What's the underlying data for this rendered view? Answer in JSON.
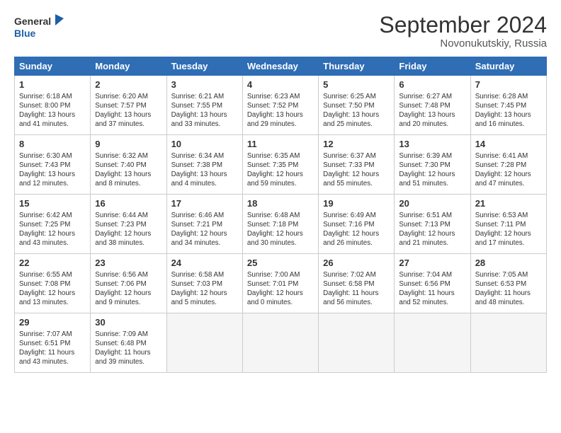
{
  "header": {
    "logo_line1": "General",
    "logo_line2": "Blue",
    "month": "September 2024",
    "location": "Novonukutskiy, Russia"
  },
  "days_of_week": [
    "Sunday",
    "Monday",
    "Tuesday",
    "Wednesday",
    "Thursday",
    "Friday",
    "Saturday"
  ],
  "weeks": [
    [
      {
        "day": "1",
        "info": "Sunrise: 6:18 AM\nSunset: 8:00 PM\nDaylight: 13 hours\nand 41 minutes."
      },
      {
        "day": "2",
        "info": "Sunrise: 6:20 AM\nSunset: 7:57 PM\nDaylight: 13 hours\nand 37 minutes."
      },
      {
        "day": "3",
        "info": "Sunrise: 6:21 AM\nSunset: 7:55 PM\nDaylight: 13 hours\nand 33 minutes."
      },
      {
        "day": "4",
        "info": "Sunrise: 6:23 AM\nSunset: 7:52 PM\nDaylight: 13 hours\nand 29 minutes."
      },
      {
        "day": "5",
        "info": "Sunrise: 6:25 AM\nSunset: 7:50 PM\nDaylight: 13 hours\nand 25 minutes."
      },
      {
        "day": "6",
        "info": "Sunrise: 6:27 AM\nSunset: 7:48 PM\nDaylight: 13 hours\nand 20 minutes."
      },
      {
        "day": "7",
        "info": "Sunrise: 6:28 AM\nSunset: 7:45 PM\nDaylight: 13 hours\nand 16 minutes."
      }
    ],
    [
      {
        "day": "8",
        "info": "Sunrise: 6:30 AM\nSunset: 7:43 PM\nDaylight: 13 hours\nand 12 minutes."
      },
      {
        "day": "9",
        "info": "Sunrise: 6:32 AM\nSunset: 7:40 PM\nDaylight: 13 hours\nand 8 minutes."
      },
      {
        "day": "10",
        "info": "Sunrise: 6:34 AM\nSunset: 7:38 PM\nDaylight: 13 hours\nand 4 minutes."
      },
      {
        "day": "11",
        "info": "Sunrise: 6:35 AM\nSunset: 7:35 PM\nDaylight: 12 hours\nand 59 minutes."
      },
      {
        "day": "12",
        "info": "Sunrise: 6:37 AM\nSunset: 7:33 PM\nDaylight: 12 hours\nand 55 minutes."
      },
      {
        "day": "13",
        "info": "Sunrise: 6:39 AM\nSunset: 7:30 PM\nDaylight: 12 hours\nand 51 minutes."
      },
      {
        "day": "14",
        "info": "Sunrise: 6:41 AM\nSunset: 7:28 PM\nDaylight: 12 hours\nand 47 minutes."
      }
    ],
    [
      {
        "day": "15",
        "info": "Sunrise: 6:42 AM\nSunset: 7:25 PM\nDaylight: 12 hours\nand 43 minutes."
      },
      {
        "day": "16",
        "info": "Sunrise: 6:44 AM\nSunset: 7:23 PM\nDaylight: 12 hours\nand 38 minutes."
      },
      {
        "day": "17",
        "info": "Sunrise: 6:46 AM\nSunset: 7:21 PM\nDaylight: 12 hours\nand 34 minutes."
      },
      {
        "day": "18",
        "info": "Sunrise: 6:48 AM\nSunset: 7:18 PM\nDaylight: 12 hours\nand 30 minutes."
      },
      {
        "day": "19",
        "info": "Sunrise: 6:49 AM\nSunset: 7:16 PM\nDaylight: 12 hours\nand 26 minutes."
      },
      {
        "day": "20",
        "info": "Sunrise: 6:51 AM\nSunset: 7:13 PM\nDaylight: 12 hours\nand 21 minutes."
      },
      {
        "day": "21",
        "info": "Sunrise: 6:53 AM\nSunset: 7:11 PM\nDaylight: 12 hours\nand 17 minutes."
      }
    ],
    [
      {
        "day": "22",
        "info": "Sunrise: 6:55 AM\nSunset: 7:08 PM\nDaylight: 12 hours\nand 13 minutes."
      },
      {
        "day": "23",
        "info": "Sunrise: 6:56 AM\nSunset: 7:06 PM\nDaylight: 12 hours\nand 9 minutes."
      },
      {
        "day": "24",
        "info": "Sunrise: 6:58 AM\nSunset: 7:03 PM\nDaylight: 12 hours\nand 5 minutes."
      },
      {
        "day": "25",
        "info": "Sunrise: 7:00 AM\nSunset: 7:01 PM\nDaylight: 12 hours\nand 0 minutes."
      },
      {
        "day": "26",
        "info": "Sunrise: 7:02 AM\nSunset: 6:58 PM\nDaylight: 11 hours\nand 56 minutes."
      },
      {
        "day": "27",
        "info": "Sunrise: 7:04 AM\nSunset: 6:56 PM\nDaylight: 11 hours\nand 52 minutes."
      },
      {
        "day": "28",
        "info": "Sunrise: 7:05 AM\nSunset: 6:53 PM\nDaylight: 11 hours\nand 48 minutes."
      }
    ],
    [
      {
        "day": "29",
        "info": "Sunrise: 7:07 AM\nSunset: 6:51 PM\nDaylight: 11 hours\nand 43 minutes."
      },
      {
        "day": "30",
        "info": "Sunrise: 7:09 AM\nSunset: 6:48 PM\nDaylight: 11 hours\nand 39 minutes."
      },
      {
        "day": "",
        "info": ""
      },
      {
        "day": "",
        "info": ""
      },
      {
        "day": "",
        "info": ""
      },
      {
        "day": "",
        "info": ""
      },
      {
        "day": "",
        "info": ""
      }
    ]
  ]
}
